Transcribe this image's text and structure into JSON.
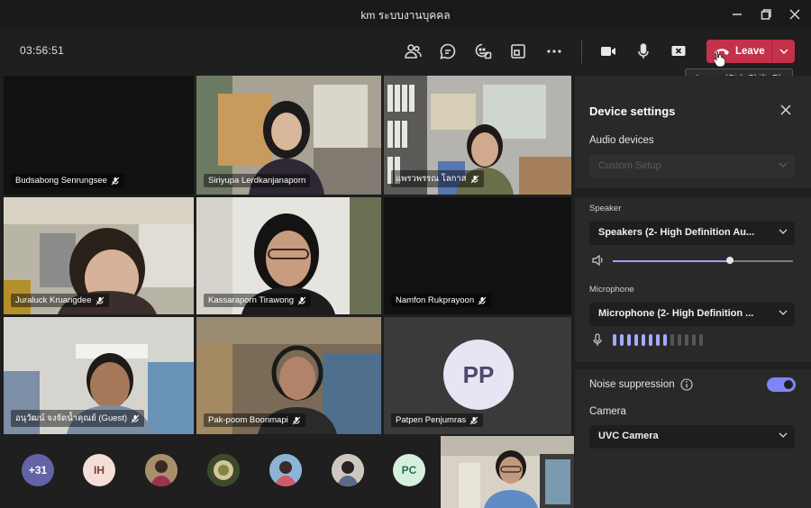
{
  "window": {
    "title": "km ระบบงานบุคคล"
  },
  "toolbar": {
    "timer": "03:56:51",
    "leave_label": "Leave",
    "leave_tooltip": "Leave (Ctrl+Shift+B)",
    "icons": [
      "people-icon",
      "chat-icon",
      "reactions-icon",
      "share-tray-icon",
      "more-icon",
      "camera-icon",
      "mic-icon",
      "share-screen-icon"
    ]
  },
  "participants": [
    {
      "name": "Budsabong Senrungsee"
    },
    {
      "name": "Siriyupa Lerdkanjanaporn"
    },
    {
      "name": "แพรวพรรณ โลกาส"
    },
    {
      "name": "Juraluck Kruangdee"
    },
    {
      "name": "Kassaraporn Tirawong"
    },
    {
      "name": "Namfon Rukprayoon"
    },
    {
      "name": "อนุวัฒน์ จงจัดน้ำคุณย์ (Guest)"
    },
    {
      "name": "Pak-poom Boonmapi"
    },
    {
      "name": "Patpen Penjumras",
      "initials": "PP"
    }
  ],
  "strip": {
    "overflow": "+31",
    "avatars": [
      {
        "initials": "IH",
        "color": "#f4dfd8",
        "text_color": "#7a3a2a"
      },
      {
        "initials": "PC",
        "color": "#d6f0e0",
        "text_color": "#1f6f45"
      }
    ]
  },
  "panel": {
    "title": "Device settings",
    "audio_devices_label": "Audio devices",
    "audio_device_value": "Custom Setup",
    "speaker_label": "Speaker",
    "speaker_value": "Speakers (2- High Definition Au...",
    "speaker_volume": 0.65,
    "microphone_label": "Microphone",
    "microphone_value": "Microphone (2- High Definition ...",
    "mic_level_bars": 13,
    "mic_level_on": 8,
    "noise_label": "Noise suppression",
    "noise_on": true,
    "camera_label": "Camera",
    "camera_value": "UVC Camera"
  },
  "colors": {
    "leave": "#c4314b",
    "accent": "#7f85f5",
    "avatar_overflow": "#6264a7"
  }
}
